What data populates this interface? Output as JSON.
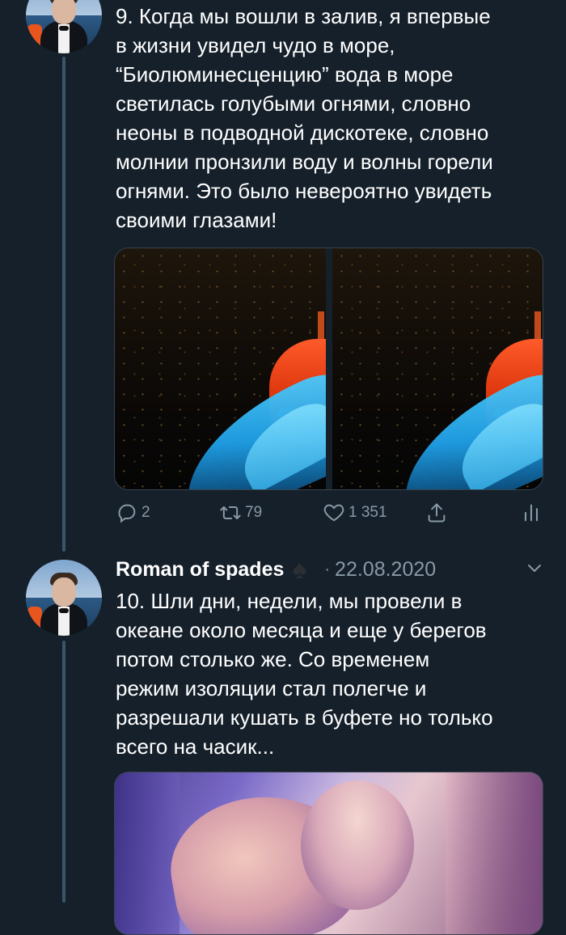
{
  "tweet1": {
    "text": "9. Когда мы вошли в залив, я впервые\nв жизни увидел чудо в море,\n“Биолюминесценцию” вода в море\nсветилась голубыми огнями, словно\nнеоны в подводной дискотеке, словно\nмолнии пронзили воду и волны горели\nогнями. Это было невероятно увидеть\nсвоими глазами!",
    "actions": {
      "reply_count": "2",
      "retweet_count": "79",
      "like_count": "1 351"
    }
  },
  "tweet2": {
    "author_name": "Roman of spades",
    "author_emoji": "♠",
    "separator": "·",
    "date": "22.08.2020",
    "text": "10. Шли дни, недели, мы провели в\nокеане около месяца и еще у берегов\nпотом столько же. Со временем\nрежим изоляции стал полегче и\nразрешали кушать в буфете но только\nвсего на часик..."
  },
  "icons": {
    "reply": "reply-icon",
    "retweet": "retweet-icon",
    "like": "heart-icon",
    "share": "share-icon",
    "stats": "analytics-icon",
    "more": "chevron-down-icon"
  },
  "colors": {
    "background": "#15202b",
    "text_primary": "#ffffff",
    "text_secondary": "#8899a6",
    "thread_line": "#3d5466",
    "border": "#38444d"
  }
}
